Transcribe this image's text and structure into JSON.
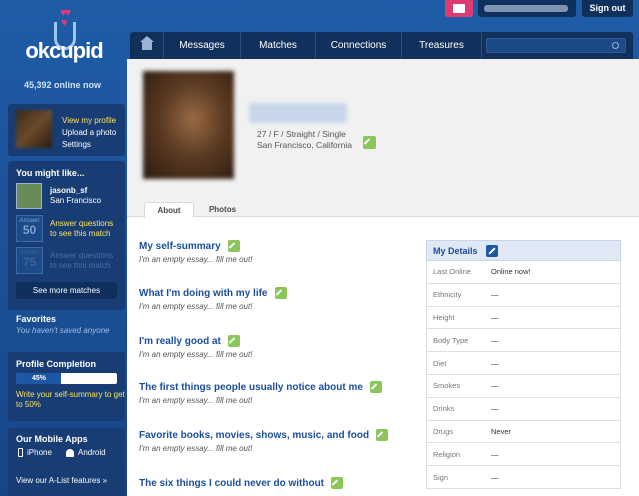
{
  "topbar": {
    "signout": "Sign out"
  },
  "logo": {
    "text": "okcupid"
  },
  "online": "45,392 online now",
  "profile_links": {
    "view": "View my profile",
    "upload": "Upload a photo",
    "settings": "Settings"
  },
  "might_like": {
    "title": "You might like...",
    "user": {
      "name": "jasonb_sf",
      "location": "San Francisco"
    },
    "cards": [
      {
        "label": "Answer",
        "number": "50",
        "text": "Answer questions to see this match"
      },
      {
        "label": "Answer",
        "number": "75",
        "text": "Answer questions to see this match"
      }
    ],
    "see_more": "See more matches"
  },
  "favorites": {
    "title": "Favorites",
    "empty": "You haven't saved anyone"
  },
  "completion": {
    "title": "Profile Completion",
    "percent_label": "45%",
    "percent": 45,
    "cta": "Write your self-summary to get to 50%"
  },
  "apps": {
    "title": "Our Mobile Apps",
    "iphone": "iPhone",
    "android": "Android",
    "alist": "View our A-List features »"
  },
  "nav": {
    "items": [
      "Messages",
      "Matches",
      "Connections",
      "Treasures"
    ],
    "search_placeholder": ""
  },
  "profile": {
    "info_line1": "27 / F / Straight / Single",
    "info_line2": "San Francisco, California",
    "tabs": [
      "About",
      "Photos"
    ]
  },
  "essays": [
    {
      "title": "My self-summary",
      "empty": "I'm an empty essay... fill me out!"
    },
    {
      "title": "What I'm doing with my life",
      "empty": "I'm an empty essay... fill me out!"
    },
    {
      "title": "I'm really good at",
      "empty": "I'm an empty essay... fill me out!"
    },
    {
      "title": "The first things people usually notice about me",
      "empty": "I'm an empty essay... fill me out!"
    },
    {
      "title": "Favorite books, movies, shows, music, and food",
      "empty": "I'm an empty essay... fill me out!"
    },
    {
      "title": "The six things I could never do without",
      "empty": ""
    }
  ],
  "details": {
    "title": "My Details",
    "rows": [
      {
        "k": "Last Online",
        "v": "Online now!"
      },
      {
        "k": "Ethnicity",
        "v": "—"
      },
      {
        "k": "Height",
        "v": "—"
      },
      {
        "k": "Body Type",
        "v": "—"
      },
      {
        "k": "Diet",
        "v": "—"
      },
      {
        "k": "Smokes",
        "v": "—"
      },
      {
        "k": "Drinks",
        "v": "—"
      },
      {
        "k": "Drugs",
        "v": "Never"
      },
      {
        "k": "Religion",
        "v": "—"
      },
      {
        "k": "Sign",
        "v": "—"
      }
    ]
  }
}
